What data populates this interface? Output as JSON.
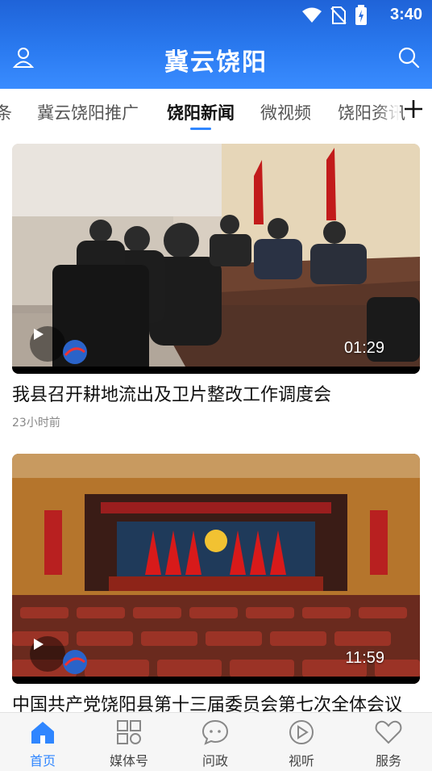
{
  "status": {
    "time": "3:40"
  },
  "app": {
    "title": "冀云饶阳"
  },
  "tabs": [
    {
      "label": "条"
    },
    {
      "label": "冀云饶阳推广"
    },
    {
      "label": "饶阳新闻"
    },
    {
      "label": "微视频"
    },
    {
      "label": "饶阳资讯"
    }
  ],
  "active_tab": "饶阳新闻",
  "colors": {
    "accent": "#2f86ff",
    "header_top": "#1f63d8",
    "header_bottom": "#3a8cff"
  },
  "feed": [
    {
      "title": "我县召开耕地流出及卫片整改工作调度会",
      "time": "23小时前",
      "duration": "01:29"
    },
    {
      "title": "中国共产党饶阳县第十三届委员会第七次全体会议",
      "time": "",
      "duration": "11:59"
    }
  ],
  "bottom_nav": [
    {
      "label": "首页",
      "icon": "home-icon"
    },
    {
      "label": "媒体号",
      "icon": "grid-icon"
    },
    {
      "label": "问政",
      "icon": "chat-icon"
    },
    {
      "label": "视听",
      "icon": "play-circle-icon"
    },
    {
      "label": "服务",
      "icon": "heart-icon"
    }
  ]
}
